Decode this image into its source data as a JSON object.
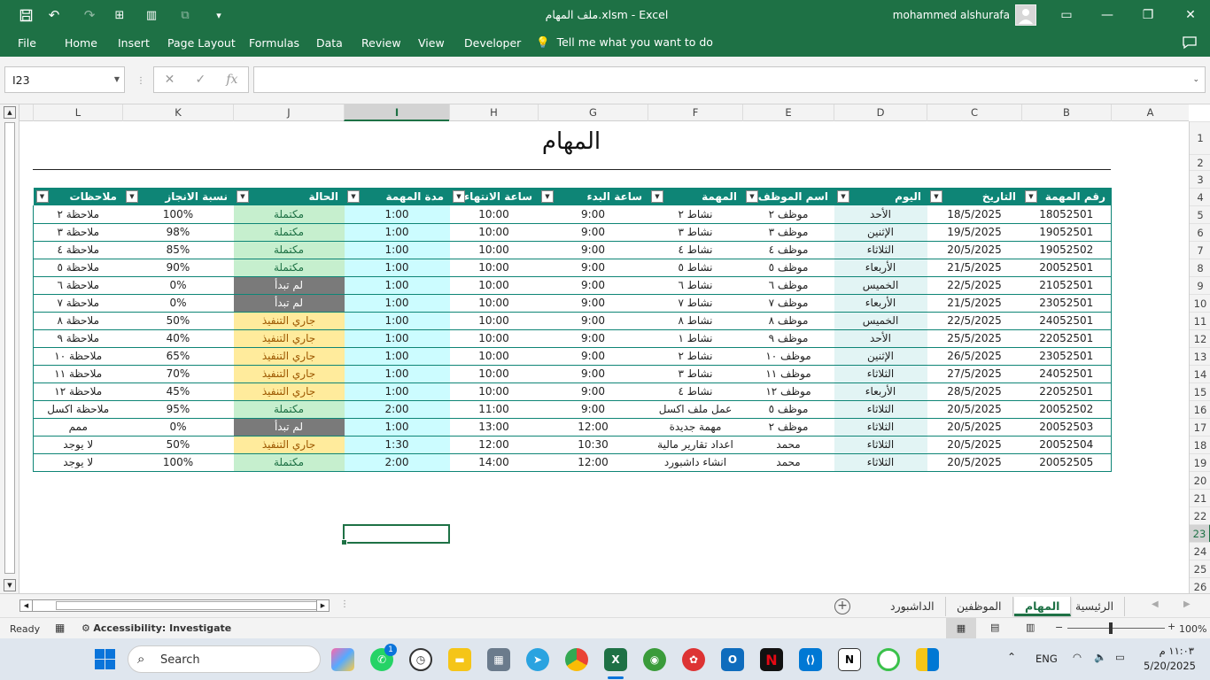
{
  "window": {
    "title": "ملف المهام.xlsm  -  Excel",
    "user": "mohammed alshurafa"
  },
  "ribbon": {
    "tabs": [
      "File",
      "Home",
      "Insert",
      "Page Layout",
      "Formulas",
      "Data",
      "Review",
      "View",
      "Developer"
    ],
    "tell_me": "Tell me what you want to do"
  },
  "formula_bar": {
    "name_box": "I23",
    "formula": "",
    "cancel_glyph": "✕",
    "enter_glyph": "✓",
    "fx_glyph": "fx"
  },
  "columns": [
    "L",
    "K",
    "J",
    "I",
    "H",
    "G",
    "F",
    "E",
    "D",
    "C",
    "B",
    "A"
  ],
  "selected_column": "I",
  "rows": [
    "1",
    "2",
    "3",
    "4",
    "5",
    "6",
    "7",
    "8",
    "9",
    "10",
    "11",
    "12",
    "13",
    "14",
    "15",
    "16",
    "17",
    "18",
    "19",
    "20",
    "21",
    "22",
    "23",
    "24",
    "25",
    "26"
  ],
  "selected_row": "23",
  "sheet": {
    "title": "المهام",
    "headers": [
      "ملاحظات",
      "نسبة الانجاز",
      "الحالة",
      "مدة المهمة",
      "ساعة الانتهاء",
      "ساعة البدء",
      "المهمة",
      "اسم الموظف",
      "اليوم",
      "التاريخ",
      "رقم المهمة"
    ],
    "rows": [
      [
        "ملاحظة ٢",
        "100%",
        "مكتملة",
        "1:00",
        "10:00",
        "9:00",
        "نشاط ٢",
        "موظف ٢",
        "الأحد",
        "18/5/2025",
        "18052501"
      ],
      [
        "ملاحظة ٣",
        "98%",
        "مكتملة",
        "1:00",
        "10:00",
        "9:00",
        "نشاط ٣",
        "موظف ٣",
        "الإثنين",
        "19/5/2025",
        "19052501"
      ],
      [
        "ملاحظة ٤",
        "85%",
        "مكتملة",
        "1:00",
        "10:00",
        "9:00",
        "نشاط ٤",
        "موظف ٤",
        "الثلاثاء",
        "20/5/2025",
        "19052502"
      ],
      [
        "ملاحظة ٥",
        "90%",
        "مكتملة",
        "1:00",
        "10:00",
        "9:00",
        "نشاط ٥",
        "موظف ٥",
        "الأربعاء",
        "21/5/2025",
        "20052501"
      ],
      [
        "ملاحظة ٦",
        "0%",
        "لم تبدأ",
        "1:00",
        "10:00",
        "9:00",
        "نشاط ٦",
        "موظف ٦",
        "الخميس",
        "22/5/2025",
        "21052501"
      ],
      [
        "ملاحظة ٧",
        "0%",
        "لم تبدأ",
        "1:00",
        "10:00",
        "9:00",
        "نشاط ٧",
        "موظف ٧",
        "الأربعاء",
        "21/5/2025",
        "23052501"
      ],
      [
        "ملاحظة ٨",
        "50%",
        "جاري التنفيذ",
        "1:00",
        "10:00",
        "9:00",
        "نشاط ٨",
        "موظف ٨",
        "الخميس",
        "22/5/2025",
        "24052501"
      ],
      [
        "ملاحظة ٩",
        "40%",
        "جاري التنفيذ",
        "1:00",
        "10:00",
        "9:00",
        "نشاط ١",
        "موظف ٩",
        "الأحد",
        "25/5/2025",
        "22052501"
      ],
      [
        "ملاحظة ١٠",
        "65%",
        "جاري التنفيذ",
        "1:00",
        "10:00",
        "9:00",
        "نشاط ٢",
        "موظف ١٠",
        "الإثنين",
        "26/5/2025",
        "23052501"
      ],
      [
        "ملاحظة ١١",
        "70%",
        "جاري التنفيذ",
        "1:00",
        "10:00",
        "9:00",
        "نشاط ٣",
        "موظف ١١",
        "الثلاثاء",
        "27/5/2025",
        "24052501"
      ],
      [
        "ملاحظة ١٢",
        "45%",
        "جاري التنفيذ",
        "1:00",
        "10:00",
        "9:00",
        "نشاط ٤",
        "موظف ١٢",
        "الأربعاء",
        "28/5/2025",
        "22052501"
      ],
      [
        "ملاحظة اكسل",
        "95%",
        "مكتملة",
        "2:00",
        "11:00",
        "9:00",
        "عمل ملف اكسل",
        "موظف ٥",
        "الثلاثاء",
        "20/5/2025",
        "20052502"
      ],
      [
        "ممم",
        "0%",
        "لم تبدأ",
        "1:00",
        "13:00",
        "12:00",
        "مهمة جديدة",
        "موظف ٢",
        "الثلاثاء",
        "20/5/2025",
        "20052503"
      ],
      [
        "لا يوجد",
        "50%",
        "جاري التنفيذ",
        "1:30",
        "12:00",
        "10:30",
        "اعداد تقارير مالية",
        "محمد",
        "الثلاثاء",
        "20/5/2025",
        "20052504"
      ],
      [
        "لا يوجد",
        "100%",
        "مكتملة",
        "2:00",
        "14:00",
        "12:00",
        "انشاء داشبورد",
        "محمد",
        "الثلاثاء",
        "20/5/2025",
        "20052505"
      ]
    ]
  },
  "status_colors": {
    "مكتملة": "done",
    "لم تبدأ": "new",
    "جاري التنفيذ": "prog"
  },
  "sheet_tabs": [
    "الداشبورد",
    "الموظفين",
    "المهام",
    "الرئيسية"
  ],
  "active_sheet": "المهام",
  "statusbar": {
    "ready": "Ready",
    "accessibility": "Accessibility: Investigate",
    "zoom": "100%"
  },
  "taskbar": {
    "search": "Search",
    "whatsapp_badge": "1",
    "lang": "ENG",
    "time": "١١:٠٣ م",
    "date": "5/20/2025"
  },
  "colors": {
    "excel_green": "#1e7145",
    "table_header": "#0e8576",
    "done_fill": "#c6efce",
    "new_fill": "#7a7a7a",
    "prog_fill": "#ffeb9c"
  }
}
